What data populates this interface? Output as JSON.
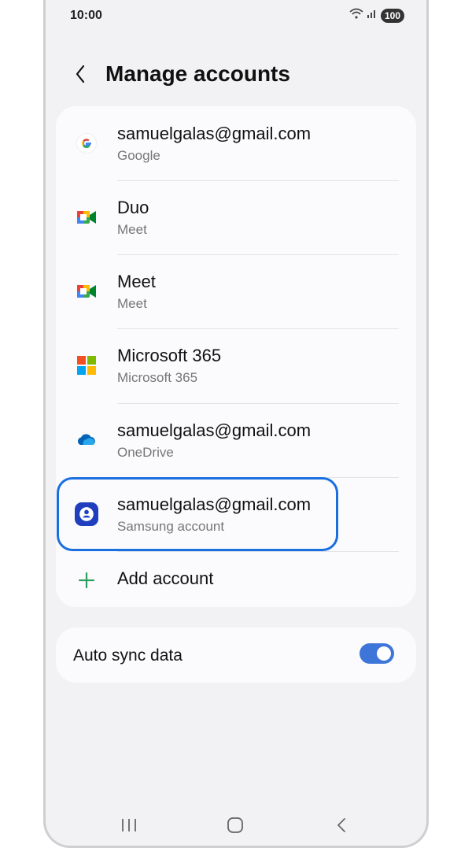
{
  "status_bar": {
    "time": "10:00",
    "battery": "100"
  },
  "header": {
    "title": "Manage accounts"
  },
  "accounts": [
    {
      "primary": "samuelgalas@gmail.com",
      "secondary": "Google",
      "icon": "google-icon"
    },
    {
      "primary": "Duo",
      "secondary": "Meet",
      "icon": "meet-icon"
    },
    {
      "primary": "Meet",
      "secondary": "Meet",
      "icon": "meet-icon"
    },
    {
      "primary": "Microsoft 365",
      "secondary": "Microsoft 365",
      "icon": "microsoft-icon"
    },
    {
      "primary": "samuelgalas@gmail.com",
      "secondary": "OneDrive",
      "icon": "onedrive-icon"
    },
    {
      "primary": "samuelgalas@gmail.com",
      "secondary": "Samsung account",
      "icon": "samsung-account-icon"
    }
  ],
  "add_account": {
    "label": "Add account"
  },
  "sync": {
    "label": "Auto sync data",
    "enabled": true
  },
  "colors": {
    "highlight": "#1a6fe0",
    "toggle_on": "#3e75d9",
    "add_plus": "#2e9e5e"
  }
}
